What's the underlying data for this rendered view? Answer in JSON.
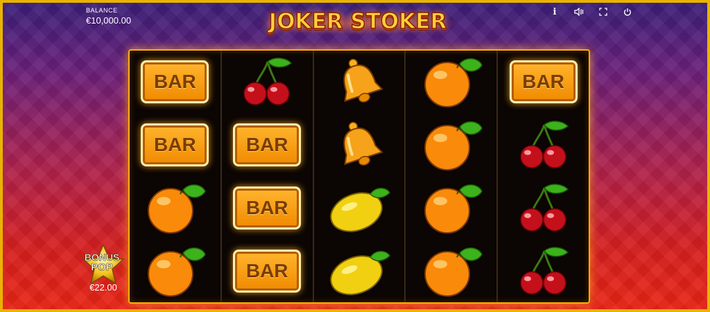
{
  "balance": {
    "label": "BALANCE",
    "value": "€10,000.00"
  },
  "logo": {
    "title": "JOKER STOKER"
  },
  "hud": {
    "icons": [
      "info-icon",
      "sound-icon",
      "fullscreen-icon",
      "power-icon"
    ],
    "info_glyph": "i"
  },
  "reels": [
    [
      "bar",
      "cherry",
      "bell",
      "orange",
      "bar"
    ],
    [
      "bar",
      "bar",
      "bell",
      "orange",
      "cherry"
    ],
    [
      "orange",
      "bar",
      "lemon",
      "orange",
      "cherry"
    ],
    [
      "orange",
      "bar",
      "lemon",
      "orange",
      "cherry"
    ]
  ],
  "symbols": {
    "bar_label": "BAR"
  },
  "bonus": {
    "line1": "BONUS",
    "line2": "POP",
    "value": "€22.00"
  },
  "colors": {
    "frame": "#e9b400",
    "reel_border": "#ffb000",
    "bar_fill": "#f6a21a",
    "bg_top": "#3a1f78",
    "bg_bottom": "#e82515"
  }
}
